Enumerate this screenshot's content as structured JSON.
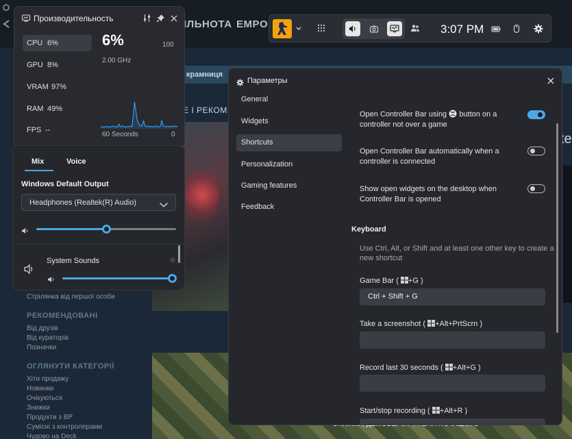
{
  "background": {
    "nav_items": [
      "ІЛЬНОТА",
      "EMPOR"
    ],
    "subbar_label": "крамниця",
    "recommend_label": "НЕ І РЕКОМ",
    "right_letter": "te",
    "sidebar": {
      "line1": "Стрілянка від першої особи",
      "recommended_heading": "РЕКОМЕНДОВАНІ",
      "recommended_items": [
        "Від друзів",
        "Від кураторів",
        "Позначки"
      ],
      "categories_heading": "ОГЛЯНУТИ КАТЕГОРІЇ",
      "category_items": [
        "Хіти продажу",
        "Новинки",
        "Очікуються",
        "Знижки",
        "Продукти з ВР",
        "Сумісні з контролерами",
        "Чудово на Deck"
      ]
    },
    "banner_text": "ЗНИЖКИ, ДЕМОВЕРСІЇ ТА БАГАТО ІНШОГО"
  },
  "gamebar": {
    "time": "3:07 PM",
    "icons": [
      "game-thumbnail",
      "chevron-down",
      "grid",
      "audio",
      "capture",
      "performance",
      "social",
      "battery",
      "mouse",
      "settings"
    ],
    "active_widgets": [
      "audio",
      "capture",
      "performance"
    ]
  },
  "performance": {
    "title": "Производительность",
    "rows": [
      {
        "label": "CPU",
        "value": "6%"
      },
      {
        "label": "GPU",
        "value": "8%"
      },
      {
        "label": "VRAM",
        "value": "97%"
      },
      {
        "label": "RAM",
        "value": "49%"
      },
      {
        "label": "FPS",
        "value": "--"
      }
    ],
    "selected": "CPU",
    "big_value": "6%",
    "max_label": "100",
    "frequency": "2.00 GHz",
    "axis_left": "60 Seconds",
    "axis_right": "0",
    "cpu_history": [
      6,
      5,
      6,
      5,
      6,
      7,
      6,
      5,
      6,
      7,
      8,
      6,
      5,
      6,
      14,
      7,
      6,
      9,
      6,
      5,
      6,
      7,
      6,
      8,
      6,
      40,
      82,
      55,
      28,
      18,
      10,
      8,
      12,
      24,
      9,
      7,
      6,
      8,
      6,
      7,
      6,
      5,
      9,
      6,
      7,
      6,
      8,
      26,
      10,
      7,
      6,
      8,
      7,
      6,
      8,
      7,
      6,
      9,
      7,
      8
    ],
    "accent": "#2f9be8"
  },
  "audio": {
    "tabs": [
      "Mix",
      "Voice"
    ],
    "active_tab": "Mix",
    "output_label": "Windows Default Output",
    "device": "Headphones (Realtek(R) Audio)",
    "master_volume": 0.5,
    "app_name": "System Sounds",
    "app_volume": 1.0
  },
  "settings": {
    "title": "Параметры",
    "nav": [
      "General",
      "Widgets",
      "Shortcuts",
      "Personalization",
      "Gaming features",
      "Feedback"
    ],
    "selected_nav": "Shortcuts",
    "options": [
      {
        "text_before": "Open Controller Bar using",
        "text_after": "button on a controller not over a game",
        "on": true
      },
      {
        "text": "Open Controller Bar automatically when a controller is connected",
        "on": false
      },
      {
        "text": "Show open widgets on the desktop when Controller Bar is opened",
        "on": false
      }
    ],
    "keyboard_heading": "Keyboard",
    "keyboard_desc": "Use Ctrl, Alt, or Shift and at least one other key to create a new shortcut",
    "shortcuts": [
      {
        "name": "Game Bar",
        "default": "+G",
        "value": "Ctrl + Shift + G"
      },
      {
        "name": "Take a screenshot",
        "default": "+Alt+PrtScrn",
        "value": ""
      },
      {
        "name": "Record last 30 seconds",
        "default": "+Alt+G",
        "value": ""
      },
      {
        "name": "Start/stop recording",
        "default": "+Alt+R",
        "value": ""
      }
    ],
    "accent": "#4aa8e8"
  }
}
